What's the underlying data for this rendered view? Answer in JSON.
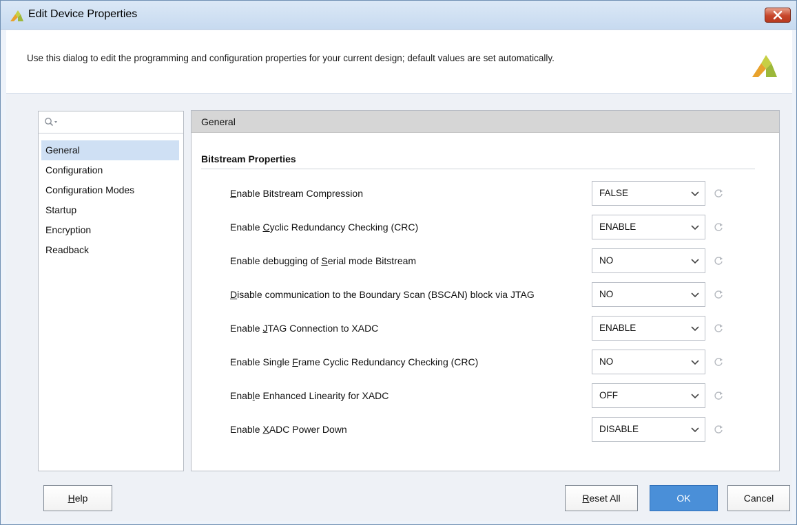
{
  "window": {
    "title": "Edit Device Properties"
  },
  "header": {
    "description": "Use this dialog to edit the programming and configuration properties for your current design; default values are set automatically."
  },
  "search": {
    "placeholder": ""
  },
  "nav": {
    "items": [
      {
        "label": "General",
        "selected": true
      },
      {
        "label": "Configuration",
        "selected": false
      },
      {
        "label": "Configuration Modes",
        "selected": false
      },
      {
        "label": "Startup",
        "selected": false
      },
      {
        "label": "Encryption",
        "selected": false
      },
      {
        "label": "Readback",
        "selected": false
      }
    ]
  },
  "panel": {
    "header": "General",
    "section_title": "Bitstream Properties"
  },
  "properties": [
    {
      "pre": "",
      "mnemonic": "E",
      "post": "nable Bitstream Compression",
      "value": "FALSE"
    },
    {
      "pre": "Enable ",
      "mnemonic": "C",
      "post": "yclic Redundancy Checking (CRC)",
      "value": "ENABLE"
    },
    {
      "pre": "Enable debugging of ",
      "mnemonic": "S",
      "post": "erial mode Bitstream",
      "value": "NO"
    },
    {
      "pre": "",
      "mnemonic": "D",
      "post": "isable communication to the Boundary Scan (BSCAN) block via JTAG",
      "value": "NO"
    },
    {
      "pre": "Enable ",
      "mnemonic": "J",
      "post": "TAG Connection to XADC",
      "value": "ENABLE"
    },
    {
      "pre": "Enable Single ",
      "mnemonic": "F",
      "post": "rame Cyclic Redundancy Checking (CRC)",
      "value": "NO"
    },
    {
      "pre": "Enab",
      "mnemonic": "l",
      "post": "e Enhanced Linearity for XADC",
      "value": "OFF"
    },
    {
      "pre": "Enable ",
      "mnemonic": "X",
      "post": "ADC Power Down",
      "value": "DISABLE"
    }
  ],
  "buttons": {
    "help": {
      "mnemonic": "H",
      "rest": "elp"
    },
    "reset_all": {
      "mnemonic": "R",
      "rest": "eset All"
    },
    "ok": "OK",
    "cancel": "Cancel"
  },
  "colors": {
    "accent": "#4a8fd8",
    "selection": "#cfe0f4",
    "close_button": "#c6452a"
  }
}
